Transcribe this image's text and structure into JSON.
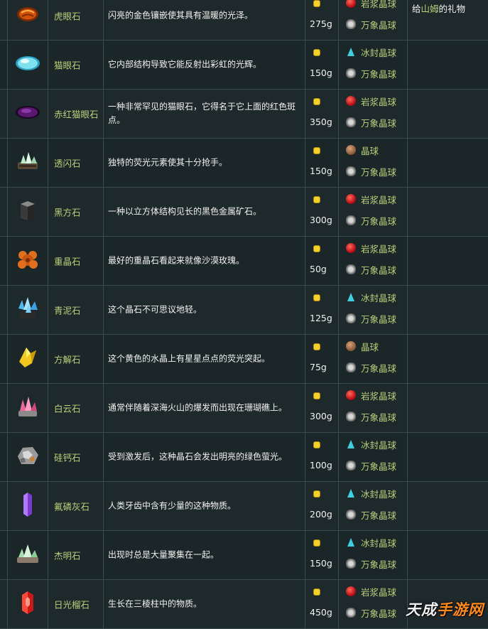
{
  "rows": [
    {
      "icon": "tigers-eye-icon",
      "name": "虎眼石",
      "desc": "闪亮的金色镶嵌使其具有温暖的光泽。",
      "price": "275g",
      "geodes": [
        {
          "icon": "magma-geode-icon",
          "label": "岩浆晶球"
        },
        {
          "icon": "omni-geode-icon",
          "label": "万象晶球"
        }
      ],
      "gift_pre": "给",
      "gift_hl": "山姆",
      "gift_post": "的礼物"
    },
    {
      "icon": "opal-icon",
      "name": "猫眼石",
      "desc": "它内部结构导致它能反射出彩虹的光辉。",
      "price": "150g",
      "geodes": [
        {
          "icon": "frozen-geode-icon",
          "label": "冰封晶球"
        },
        {
          "icon": "omni-geode-icon",
          "label": "万象晶球"
        }
      ]
    },
    {
      "icon": "fire-opal-icon",
      "name": "赤红猫眼石",
      "desc": "一种非常罕见的猫眼石，它得名于它上面的红色斑点。",
      "price": "350g",
      "geodes": [
        {
          "icon": "magma-geode-icon",
          "label": "岩浆晶球"
        },
        {
          "icon": "omni-geode-icon",
          "label": "万象晶球"
        }
      ]
    },
    {
      "icon": "fluorapatite-icon",
      "name": "透闪石",
      "desc": "独特的荧光元素使其十分抢手。",
      "price": "150g",
      "geodes": [
        {
          "icon": "geode-icon",
          "label": "晶球"
        },
        {
          "icon": "omni-geode-icon",
          "label": "万象晶球"
        }
      ]
    },
    {
      "icon": "cube-mineral-icon",
      "name": "黑方石",
      "desc": "一种以立方体结构见长的黑色金属矿石。",
      "price": "300g",
      "geodes": [
        {
          "icon": "magma-geode-icon",
          "label": "岩浆晶球"
        },
        {
          "icon": "omni-geode-icon",
          "label": "万象晶球"
        }
      ]
    },
    {
      "icon": "baryte-icon",
      "name": "重晶石",
      "desc": "最好的重晶石看起来就像沙漠玫瑰。",
      "price": "50g",
      "geodes": [
        {
          "icon": "magma-geode-icon",
          "label": "岩浆晶球"
        },
        {
          "icon": "omni-geode-icon",
          "label": "万象晶球"
        }
      ]
    },
    {
      "icon": "blue-crystal-icon",
      "name": "青泥石",
      "desc": "这个晶石不可思议地轻。",
      "price": "125g",
      "geodes": [
        {
          "icon": "frozen-geode-icon",
          "label": "冰封晶球"
        },
        {
          "icon": "omni-geode-icon",
          "label": "万象晶球"
        }
      ]
    },
    {
      "icon": "yellow-crystal-icon",
      "name": "方解石",
      "desc": "这个黄色的水晶上有星星点点的荧光突起。",
      "price": "75g",
      "geodes": [
        {
          "icon": "geode-icon",
          "label": "晶球"
        },
        {
          "icon": "omni-geode-icon",
          "label": "万象晶球"
        }
      ]
    },
    {
      "icon": "pink-crystal-icon",
      "name": "白云石",
      "desc": "通常伴随着深海火山的爆发而出现在珊瑚礁上。",
      "price": "300g",
      "geodes": [
        {
          "icon": "magma-geode-icon",
          "label": "岩浆晶球"
        },
        {
          "icon": "omni-geode-icon",
          "label": "万象晶球"
        }
      ]
    },
    {
      "icon": "grey-ore-icon",
      "name": "硅钙石",
      "desc": "受到激发后，这种晶石会发出明亮的绿色萤光。",
      "price": "100g",
      "geodes": [
        {
          "icon": "frozen-geode-icon",
          "label": "冰封晶球"
        },
        {
          "icon": "omni-geode-icon",
          "label": "万象晶球"
        }
      ]
    },
    {
      "icon": "purple-crystal-icon",
      "name": "氟磷灰石",
      "desc": "人类牙齿中含有少量的这种物质。",
      "price": "200g",
      "geodes": [
        {
          "icon": "frozen-geode-icon",
          "label": "冰封晶球"
        },
        {
          "icon": "omni-geode-icon",
          "label": "万象晶球"
        }
      ]
    },
    {
      "icon": "green-cluster-icon",
      "name": "杰明石",
      "desc": "出现时总是大量聚集在一起。",
      "price": "150g",
      "geodes": [
        {
          "icon": "frozen-geode-icon",
          "label": "冰封晶球"
        },
        {
          "icon": "omni-geode-icon",
          "label": "万象晶球"
        }
      ]
    },
    {
      "icon": "red-crystal-icon",
      "name": "日光榴石",
      "desc": "生长在三棱柱中的物质。",
      "price": "450g",
      "geodes": [
        {
          "icon": "magma-geode-icon",
          "label": "岩浆晶球"
        },
        {
          "icon": "omni-geode-icon",
          "label": "万象晶球"
        }
      ]
    }
  ],
  "watermark": {
    "part1": "天成",
    "part2": "手游网"
  }
}
